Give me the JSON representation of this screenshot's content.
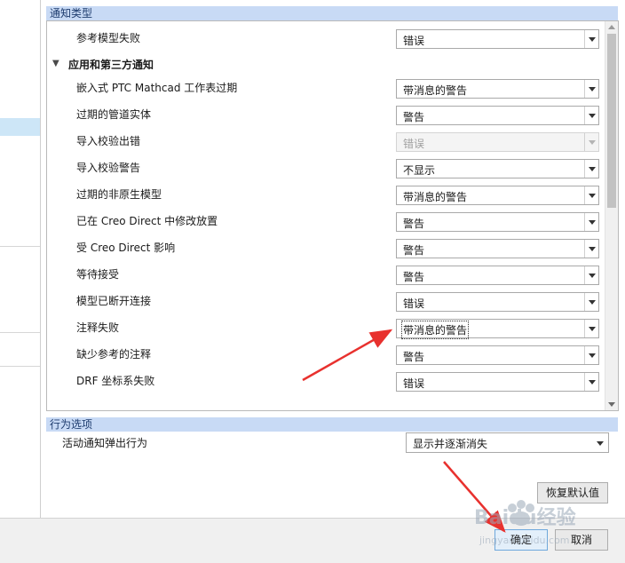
{
  "sections": {
    "notification_types": "通知类型",
    "behavior_options": "行为选项"
  },
  "group": {
    "label": "应用和第三方通知",
    "toggle_icon": "▼"
  },
  "first_row": {
    "label": "参考模型失败",
    "value": "错误"
  },
  "rows": [
    {
      "label": "嵌入式 PTC  Mathcad 工作表过期",
      "value": "带消息的警告"
    },
    {
      "label": "过期的管道实体",
      "value": "警告"
    },
    {
      "label": "导入校验出错",
      "value": "错误",
      "disabled": true
    },
    {
      "label": "导入校验警告",
      "value": "不显示"
    },
    {
      "label": "过期的非原生模型",
      "value": "带消息的警告"
    },
    {
      "label": "已在 Creo Direct 中修改放置",
      "value": "警告"
    },
    {
      "label": "受 Creo Direct 影响",
      "value": "警告"
    },
    {
      "label": "等待接受",
      "value": "警告"
    },
    {
      "label": "模型已断开连接",
      "value": "错误"
    },
    {
      "label": "注释失败",
      "value": "带消息的警告",
      "focused": true
    },
    {
      "label": "缺少参考的注释",
      "value": "警告"
    },
    {
      "label": "DRF 坐标系失败",
      "value": "错误"
    }
  ],
  "behavior": {
    "label": "活动通知弹出行为",
    "value": "显示并逐渐消失"
  },
  "buttons": {
    "restore_defaults": "恢复默认值",
    "ok": "确定",
    "cancel": "取消"
  },
  "watermark": {
    "brand": "Baidu经验",
    "url": "jingyan.baidu.com"
  },
  "colors": {
    "section_header": "#c8daf5",
    "annotation_arrow": "#e8312e",
    "selection": "#cde6f7"
  }
}
